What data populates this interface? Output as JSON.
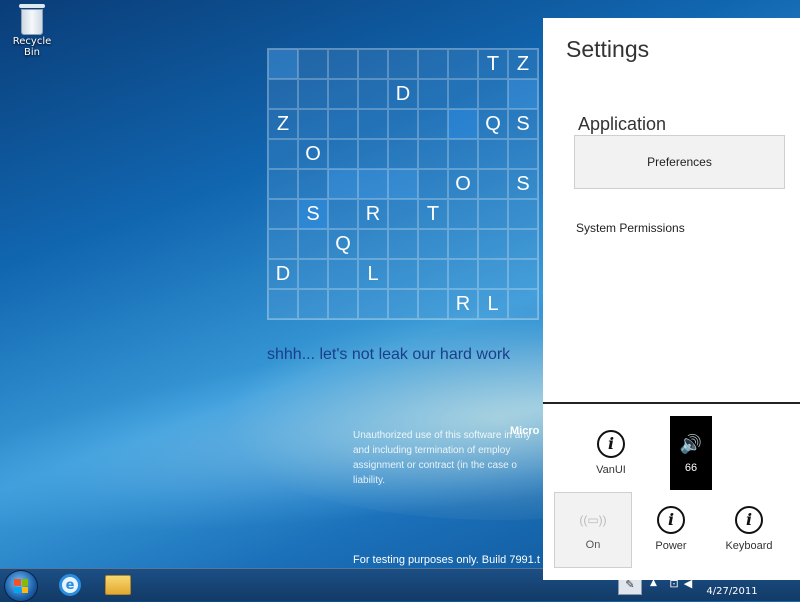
{
  "desktop": {
    "recycle_bin_label": "Recycle Bin",
    "tagline": "shhh... let's not leak our hard work",
    "legal_brand": "Micro",
    "legal_lines": [
      "Unauthorized use of this software in any",
      "and including termination of employ",
      "assignment or contract (in the case o",
      "liability."
    ],
    "build_text": "For testing purposes only. Build 7991.t"
  },
  "grid": {
    "rows": [
      [
        "",
        "",
        "",
        "",
        "",
        "",
        "",
        "T",
        "Z"
      ],
      [
        "",
        "",
        "",
        "",
        "D",
        "",
        "",
        "",
        ""
      ],
      [
        "Z",
        "",
        "",
        "",
        "",
        "",
        "",
        "Q",
        "S"
      ],
      [
        "",
        "O",
        "",
        "",
        "",
        "",
        "",
        "",
        ""
      ],
      [
        "",
        "",
        "",
        "",
        "",
        "",
        "O",
        "",
        "S"
      ],
      [
        "",
        "S",
        "",
        "R",
        "",
        "T",
        "",
        "",
        ""
      ],
      [
        "",
        "",
        "Q",
        "",
        "",
        "",
        "",
        "",
        ""
      ],
      [
        "D",
        "",
        "",
        "L",
        "",
        "",
        "",
        "",
        ""
      ],
      [
        "",
        "",
        "",
        "",
        "",
        "",
        "R",
        "L",
        ""
      ]
    ]
  },
  "settings": {
    "title": "Settings",
    "section": "Application",
    "preferences_label": "Preferences",
    "permissions_label": "System Permissions",
    "quick": {
      "vanui_label": "VanUI",
      "volume_value": "66",
      "network_label": "On",
      "power_label": "Power",
      "keyboard_label": "Keyboard"
    }
  },
  "taskbar": {
    "date": "4/27/2011"
  }
}
